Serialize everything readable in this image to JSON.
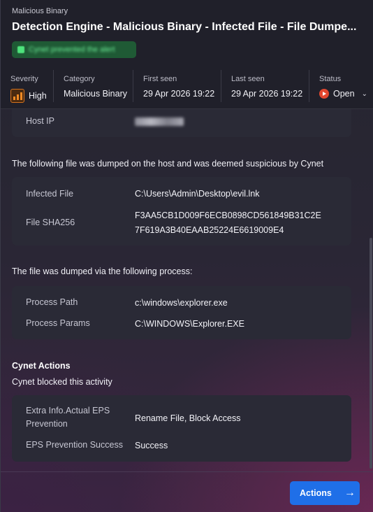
{
  "header": {
    "breadcrumb": "Malicious Binary",
    "title": "Detection Engine - Malicious Binary - Infected File - File Dumpe...",
    "badge_text": "Cynet prevented the alert",
    "badge_color": "#1f5a35"
  },
  "meta": {
    "severity": {
      "label": "Severity",
      "value": "High",
      "icon": "severity-bars-icon",
      "color": "#f08a24"
    },
    "category": {
      "label": "Category",
      "value": "Malicious Binary"
    },
    "first_seen": {
      "label": "First seen",
      "value": "29 Apr 2026 19:22"
    },
    "last_seen": {
      "label": "Last seen",
      "value": "29 Apr 2026 19:22"
    },
    "status": {
      "label": "Status",
      "value": "Open",
      "icon": "status-open-icon",
      "color": "#e2472f"
    }
  },
  "host": {
    "label": "Host IP"
  },
  "file_section": {
    "intro": "The following file was dumped on the host and was deemed suspicious by Cynet",
    "infected_file_label": "Infected File",
    "infected_file_value": "C:\\Users\\Admin\\Desktop\\evil.lnk",
    "sha_label": "File SHA256",
    "sha_line1": "F3AA5CB1D009F6ECB0898CD561849B31C2E",
    "sha_line2": "7F619A3B40EAAB25224E6619009E4"
  },
  "process_section": {
    "intro": "The file was dumped via the following process:",
    "path_label": "Process Path",
    "path_value": "c:\\windows\\explorer.exe",
    "params_label": "Process Params",
    "params_value": "C:\\WINDOWS\\Explorer.EXE"
  },
  "cynet_actions": {
    "heading": "Cynet Actions",
    "summary": "Cynet blocked this activity",
    "extra_label_1": "Extra Info.Actual EPS",
    "extra_label_2": "Prevention",
    "extra_value": "Rename File, Block Access",
    "success_label": "EPS Prevention Success",
    "success_value": "Success"
  },
  "footer": {
    "actions_label": "Actions",
    "actions_icon": "arrow-right-icon",
    "accent": "#1f6fe8"
  }
}
